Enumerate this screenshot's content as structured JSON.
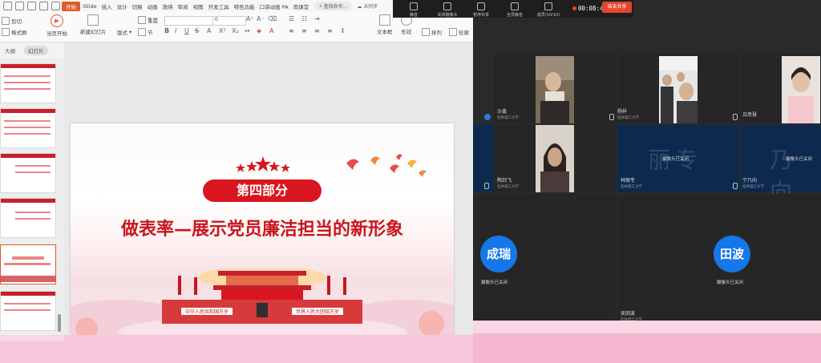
{
  "menu": {
    "items": [
      "iSlide",
      "插入",
      "设计",
      "切换",
      "动画",
      "放映",
      "审阅",
      "视图",
      "开发工具",
      "特色功能",
      "口袋动画 PA",
      "雨课堂"
    ],
    "active": "开始",
    "search": "查找命令...",
    "sync": "未同步"
  },
  "ribbon": {
    "cut": "剪切",
    "format_painter": "格式刷",
    "play_from_start": "当页开始",
    "new_slide": "新建幻灯片",
    "layout": "版式",
    "section": "节",
    "reset": "重置",
    "font_size": "0",
    "text_box": "文本框",
    "shape": "形状",
    "arrange": "排列",
    "outline": "轮廓"
  },
  "panel": {
    "tab_outline": "大纲",
    "tab_slides": "幻灯片"
  },
  "slide": {
    "part_label": "第四部分",
    "title": "做表率—展示党员廉洁担当的新形象",
    "gate_left_banner": "中华人民共和国万岁",
    "gate_right_banner": "世界人民大团结万岁"
  },
  "meeting_toolbar": {
    "buttons": [
      "静音",
      "关闭摄像头",
      "暂停共享",
      "全员静音",
      "成员(10/10)"
    ],
    "timer": "00:08:47",
    "end_share": "结束共享"
  },
  "participants": [
    {
      "name": "沙鑫",
      "org": "桂林理工大学"
    },
    {
      "name": "杨梓",
      "org": "桂林理工大学"
    },
    {
      "name": "吕思慧",
      "org": ""
    },
    {
      "name": "陶剑飞",
      "org": "桂林理工大学"
    },
    {
      "name": "林丽专",
      "org": "桂林理工大学",
      "status": "摄像头已关闭",
      "watermark": "丽专"
    },
    {
      "name": "宁乃向",
      "org": "桂林理工大学",
      "status": "摄像头已关闭",
      "watermark": "乃向"
    },
    {
      "name": "成瑞",
      "avatar": "成瑞",
      "status": "摄像头已关闭"
    },
    {
      "name": "吴田波",
      "org": "桂林理工大学",
      "avatar": "田波",
      "status": "摄像头已关闭"
    }
  ],
  "colors": {
    "accent": "#e05a2b",
    "slide_red": "#d9161f",
    "avatar_blue": "#1677e8",
    "end_share": "#e8432b"
  }
}
